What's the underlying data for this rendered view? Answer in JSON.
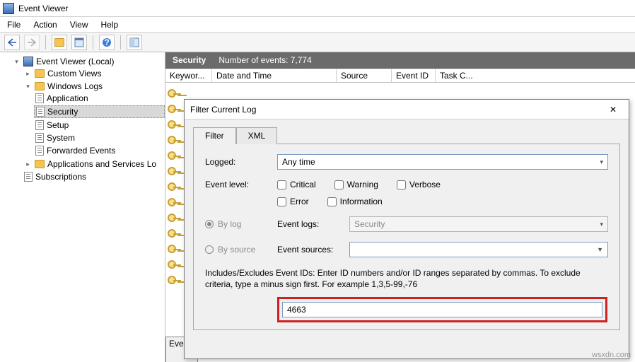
{
  "window": {
    "title": "Event Viewer"
  },
  "menu": {
    "file": "File",
    "action": "Action",
    "view": "View",
    "help": "Help"
  },
  "tree": {
    "root": "Event Viewer (Local)",
    "custom": "Custom Views",
    "winlogs": "Windows Logs",
    "items": {
      "application": "Application",
      "security": "Security",
      "setup": "Setup",
      "system": "System",
      "forwarded": "Forwarded Events"
    },
    "appsrv": "Applications and Services Lo",
    "subs": "Subscriptions"
  },
  "header": {
    "title": "Security",
    "events_label": "Number of events:",
    "events_count": "7,774"
  },
  "columns": {
    "keywords": "Keywor...",
    "datetime": "Date and Time",
    "source": "Source",
    "eventid": "Event ID",
    "taskc": "Task C..."
  },
  "bottom_tab": "Ever",
  "dialog": {
    "title": "Filter Current Log",
    "tabs": {
      "filter": "Filter",
      "xml": "XML"
    },
    "logged": {
      "label": "Logged:",
      "value": "Any time"
    },
    "level": {
      "label": "Event level:",
      "critical": "Critical",
      "warning": "Warning",
      "verbose": "Verbose",
      "error": "Error",
      "information": "Information"
    },
    "bylog": "By log",
    "bysource": "By source",
    "eventlogs": {
      "label": "Event logs:",
      "value": "Security"
    },
    "eventsources": {
      "label": "Event sources:"
    },
    "help": "Includes/Excludes Event IDs: Enter ID numbers and/or ID ranges separated by commas. To exclude criteria, type a minus sign first. For example 1,3,5-99,-76",
    "id_value": "4663"
  },
  "watermark": "wsxdn.com"
}
